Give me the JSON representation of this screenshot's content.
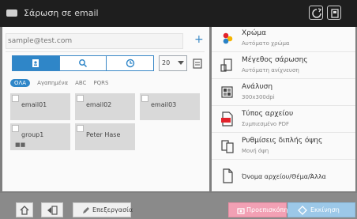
{
  "titlebar": {
    "title": "Σάρωση σε email",
    "icons": [
      "screen-icon",
      "refresh-icon",
      "settings-icon"
    ]
  },
  "address": {
    "placeholder": "sample@test.com",
    "add_icon": "plus-icon"
  },
  "view_tabs": [
    {
      "name": "address-book-icon",
      "active": true
    },
    {
      "name": "search-icon",
      "active": false
    },
    {
      "name": "history-icon",
      "active": false
    }
  ],
  "index_select": {
    "value": "20"
  },
  "filters": [
    "ΟΛΑ",
    "Αγαπημένα",
    "ABC",
    "PQRS"
  ],
  "destinations": [
    {
      "label": "email01",
      "group": false
    },
    {
      "label": "email02",
      "group": false
    },
    {
      "label": "email03",
      "group": false
    },
    {
      "label": "group1",
      "group": true
    },
    {
      "label": "Peter Hase",
      "group": false
    }
  ],
  "settings": [
    {
      "title": "Χρώμα",
      "value": "Αυτόματο χρώμα",
      "icon": "color-icon"
    },
    {
      "title": "Μέγεθος σάρωσης",
      "value": "Αυτόματη ανίχνευση",
      "icon": "scan-size-icon"
    },
    {
      "title": "Ανάλυση",
      "value": "300x300dpi",
      "icon": "resolution-icon"
    },
    {
      "title": "Τύπος αρχείου",
      "value": "Συμπιεσμένο PDF",
      "icon": "file-type-icon"
    },
    {
      "title": "Ρυθμίσεις διπλής όψης",
      "value": "Μονή όψη",
      "icon": "duplex-icon"
    },
    {
      "title": "Όνομα αρχείου/Θέμα/Άλλα",
      "value": "",
      "icon": "document-icon"
    }
  ],
  "bottom": {
    "home_icon": "home-icon",
    "back_icon": "back-icon",
    "edit_label": "Επεξεργασία",
    "review_label": "Προεπισκόπηση",
    "start_label": "Εκκίνηση"
  },
  "colors": {
    "accent_blue": "#2f86c8",
    "review_pink": "#f2a0b4",
    "start_blue": "#9cc8e8"
  }
}
